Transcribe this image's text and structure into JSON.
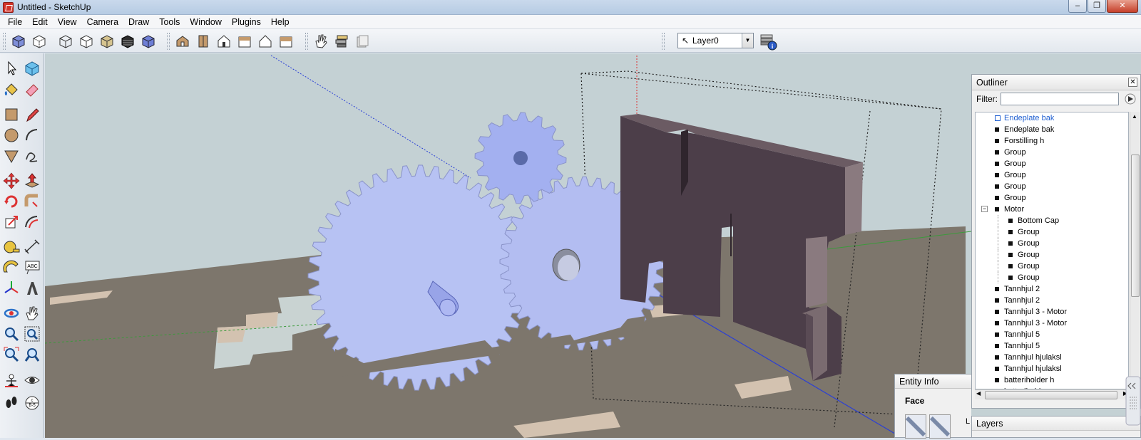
{
  "window": {
    "title": "Untitled - SketchUp",
    "minimize": "–",
    "restore": "❐",
    "close": "✕"
  },
  "menu": [
    "File",
    "Edit",
    "View",
    "Camera",
    "Draw",
    "Tools",
    "Window",
    "Plugins",
    "Help"
  ],
  "layer_selector": {
    "value": "Layer0"
  },
  "outliner": {
    "title": "Outliner",
    "filter_label": "Filter:",
    "filter_value": "",
    "items": [
      {
        "label": "Endeplate bak",
        "level": 0,
        "selected": true
      },
      {
        "label": "Endeplate bak",
        "level": 0
      },
      {
        "label": "Forstilling h",
        "level": 0
      },
      {
        "label": "Group",
        "level": 0
      },
      {
        "label": "Group",
        "level": 0
      },
      {
        "label": "Group",
        "level": 0
      },
      {
        "label": "Group",
        "level": 0
      },
      {
        "label": "Group",
        "level": 0
      },
      {
        "label": "Motor",
        "level": 0,
        "expanded": true
      },
      {
        "label": "Bottom Cap",
        "level": 1
      },
      {
        "label": "Group",
        "level": 1
      },
      {
        "label": "Group",
        "level": 1
      },
      {
        "label": "Group",
        "level": 1
      },
      {
        "label": "Group",
        "level": 1
      },
      {
        "label": "Group",
        "level": 1
      },
      {
        "label": "Tannhjul 2",
        "level": 0
      },
      {
        "label": "Tannhjul 2",
        "level": 0
      },
      {
        "label": "Tannhjul 3 - Motor",
        "level": 0
      },
      {
        "label": "Tannhjul 3 - Motor",
        "level": 0
      },
      {
        "label": "Tannhjul 5",
        "level": 0
      },
      {
        "label": "Tannhjul 5",
        "level": 0
      },
      {
        "label": "Tannhjul hjulaksl",
        "level": 0
      },
      {
        "label": "Tannhjul hjulaksl",
        "level": 0
      },
      {
        "label": "batteriholder h",
        "level": 0
      },
      {
        "label": "batteriholder v",
        "level": 0
      }
    ]
  },
  "entity_info": {
    "title": "Entity Info",
    "type": "Face"
  },
  "layers_panel": {
    "title": "Layers",
    "partial_label": "L"
  },
  "colors": {
    "gear": "#b7c2f3",
    "panel": "#5b4a55",
    "ground": "#7d766c",
    "sky": "#c4d1d4",
    "selection": "#1f5fd1"
  }
}
